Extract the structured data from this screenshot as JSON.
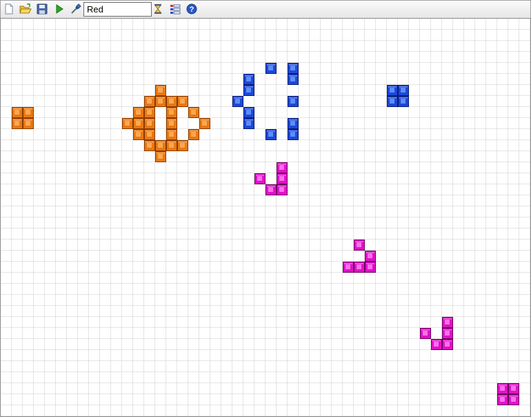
{
  "toolbar": {
    "buttons": [
      {
        "name": "new-file-button",
        "icon": "new-file-icon"
      },
      {
        "name": "open-folder-button",
        "icon": "open-folder-icon"
      },
      {
        "name": "save-button",
        "icon": "floppy-save-icon"
      },
      {
        "name": "run-button",
        "icon": "play-icon"
      },
      {
        "name": "color-picker-button",
        "icon": "eyedropper-icon"
      }
    ],
    "color_value": "Red",
    "right_buttons": [
      {
        "name": "speed-button",
        "icon": "hourglass-icon"
      },
      {
        "name": "settings-button",
        "icon": "list-settings-icon"
      },
      {
        "name": "help-button",
        "icon": "help-icon"
      }
    ]
  },
  "colors": {
    "orange": "#e87810",
    "blue": "#1c48d8",
    "magenta": "#e010c8",
    "grid_line": "#c8c8c8"
  },
  "grid": {
    "cols": 48,
    "rows": 36,
    "cells": {
      "orange": [
        [
          1,
          8
        ],
        [
          2,
          8
        ],
        [
          1,
          9
        ],
        [
          2,
          9
        ],
        [
          14,
          6
        ],
        [
          13,
          7
        ],
        [
          14,
          7
        ],
        [
          15,
          7
        ],
        [
          16,
          7
        ],
        [
          12,
          8
        ],
        [
          13,
          8
        ],
        [
          15,
          8
        ],
        [
          17,
          8
        ],
        [
          11,
          9
        ],
        [
          12,
          9
        ],
        [
          13,
          9
        ],
        [
          15,
          9
        ],
        [
          18,
          9
        ],
        [
          12,
          10
        ],
        [
          13,
          10
        ],
        [
          15,
          10
        ],
        [
          17,
          10
        ],
        [
          13,
          11
        ],
        [
          14,
          11
        ],
        [
          15,
          11
        ],
        [
          16,
          11
        ],
        [
          14,
          12
        ]
      ],
      "blue": [
        [
          24,
          4
        ],
        [
          26,
          4
        ],
        [
          22,
          5
        ],
        [
          26,
          5
        ],
        [
          22,
          6
        ],
        [
          21,
          7
        ],
        [
          26,
          7
        ],
        [
          22,
          8
        ],
        [
          22,
          9
        ],
        [
          26,
          9
        ],
        [
          24,
          10
        ],
        [
          26,
          10
        ],
        [
          35,
          6
        ],
        [
          36,
          6
        ],
        [
          35,
          7
        ],
        [
          36,
          7
        ]
      ],
      "magenta": [
        [
          25,
          13
        ],
        [
          23,
          14
        ],
        [
          25,
          14
        ],
        [
          24,
          15
        ],
        [
          25,
          15
        ],
        [
          32,
          20
        ],
        [
          33,
          21
        ],
        [
          31,
          22
        ],
        [
          32,
          22
        ],
        [
          33,
          22
        ],
        [
          40,
          27
        ],
        [
          38,
          28
        ],
        [
          40,
          28
        ],
        [
          39,
          29
        ],
        [
          40,
          29
        ],
        [
          45,
          33
        ],
        [
          46,
          33
        ],
        [
          45,
          34
        ],
        [
          46,
          34
        ]
      ]
    }
  }
}
